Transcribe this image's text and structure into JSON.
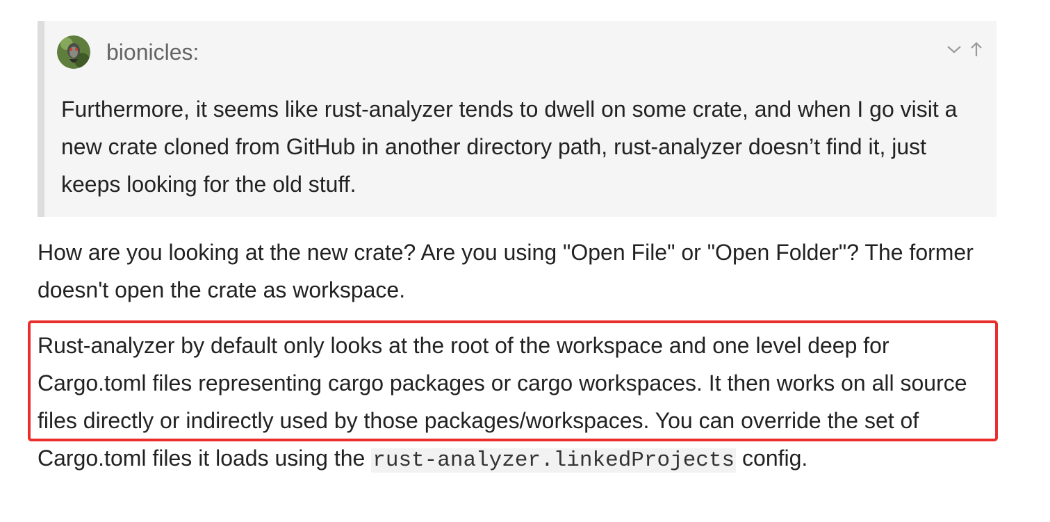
{
  "quote": {
    "username": "bionicles:",
    "text": "Furthermore, it seems like rust-analyzer tends to dwell on some crate, and when I go visit a new crate cloned from GitHub in another directory path, rust-analyzer doesn’t find it, just keeps looking for the old stuff.",
    "controls": [
      "chevron-down-icon",
      "arrow-up-icon"
    ]
  },
  "post": {
    "paragraph1": "How are you looking at the new crate? Are you using \"Open File\" or \"Open Folder\"? The former doesn't open the crate as workspace.",
    "paragraph2_before": "Rust-analyzer by default only looks at the root of the workspace and one level deep for Cargo.toml files representing cargo packages or cargo workspaces. It then works on all source files directly or indirectly used by those packages/workspaces. You can override the set of Cargo.toml files it loads using the ",
    "paragraph2_code": "rust-analyzer.linkedProjects",
    "paragraph2_after": " config."
  },
  "colors": {
    "highlight_border": "#ea2e2b",
    "quote_background": "#f5f5f5",
    "quote_border": "#dddddd"
  }
}
